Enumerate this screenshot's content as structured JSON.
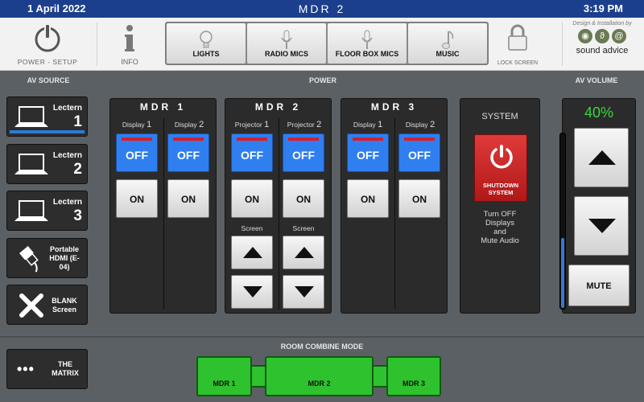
{
  "topbar": {
    "date": "1 April 2022",
    "title": "MDR 2",
    "time": "3:19 PM"
  },
  "header": {
    "power_setup": "POWER - SETUP",
    "info": "INFO",
    "nav": [
      {
        "label": "LIGHTS",
        "icon": "lightbulb-icon"
      },
      {
        "label": "RADIO MICS",
        "icon": "microphone-icon"
      },
      {
        "label": "FLOOR BOX MICS",
        "icon": "microphone-icon"
      },
      {
        "label": "MUSIC",
        "icon": "music-note-icon"
      }
    ],
    "lock_screen": "LOCK SCREEN",
    "brand_tag": "Design & Installation by",
    "brand_name": "sound advice"
  },
  "sidebar": {
    "title": "AV SOURCE",
    "sources": [
      {
        "label": "Lectern",
        "number": "1",
        "active": true
      },
      {
        "label": "Lectern",
        "number": "2"
      },
      {
        "label": "Lectern",
        "number": "3"
      },
      {
        "label": "Portable HDMI (E-04)"
      },
      {
        "label": "BLANK Screen"
      }
    ]
  },
  "power": {
    "title": "POWER",
    "mdr1": {
      "title": "MDR 1",
      "cols": [
        {
          "name": "Display",
          "num": "1"
        },
        {
          "name": "Display",
          "num": "2"
        }
      ]
    },
    "mdr2": {
      "title": "MDR 2",
      "cols": [
        {
          "name": "Projector",
          "num": "1"
        },
        {
          "name": "Projector",
          "num": "2"
        }
      ],
      "screen_label": "Screen"
    },
    "mdr3": {
      "title": "MDR 3",
      "cols": [
        {
          "name": "Display",
          "num": "1"
        },
        {
          "name": "Display",
          "num": "2"
        }
      ]
    },
    "off_label": "OFF",
    "on_label": "ON",
    "system": {
      "title": "SYSTEM",
      "shutdown_label": "SHUTDOWN SYSTEM",
      "desc_lines": [
        "Turn OFF",
        "Displays",
        "and",
        "Mute Audio"
      ]
    }
  },
  "volume": {
    "title": "AV VOLUME",
    "percent_text": "40%",
    "level": 0.4,
    "mute_label": "MUTE"
  },
  "bottom": {
    "matrix_label": "THE MATRIX",
    "room_combine_title": "ROOM COMBINE MODE",
    "rooms": [
      "MDR 1",
      "MDR 2",
      "MDR 3"
    ]
  },
  "colors": {
    "accent_blue": "#2f7ff0",
    "header_blue": "#1b3f8c",
    "volume_green": "#38d63e",
    "room_green": "#2ec22e",
    "shutdown_red": "#d02222"
  }
}
